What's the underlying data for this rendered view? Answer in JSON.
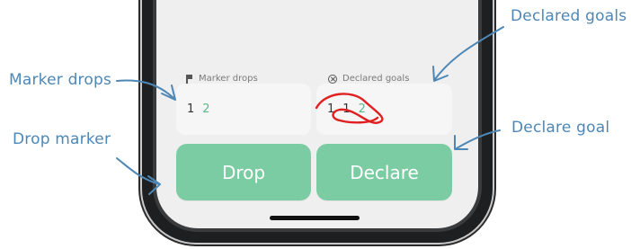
{
  "app": {
    "marker_drops": {
      "label": "Marker drops",
      "values": [
        "1",
        "2"
      ],
      "highlight_index": 1
    },
    "declared_goals": {
      "label": "Declared goals",
      "values": [
        "1",
        "1",
        "2"
      ],
      "highlight_index": 2
    },
    "buttons": {
      "drop_label": "Drop",
      "declare_label": "Declare"
    }
  },
  "callouts": {
    "marker_drops": "Marker drops",
    "drop_marker": "Drop marker",
    "declared_goals": "Declared goals",
    "declare_goal": "Declare goal"
  },
  "colors": {
    "accent_green": "#7ccca3",
    "highlight_green": "#59b889",
    "callout_blue": "#4d87b6",
    "annotation_red": "#e02020"
  }
}
